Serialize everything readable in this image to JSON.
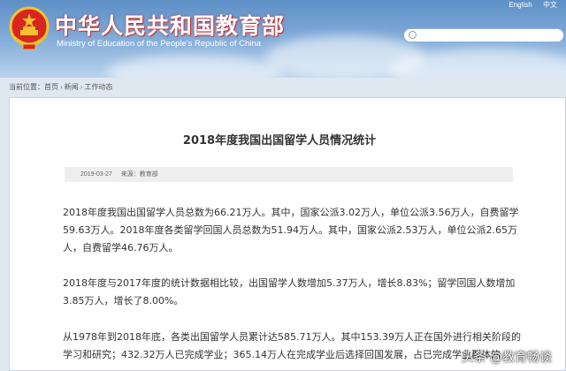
{
  "header": {
    "site_title": "中华人民共和国教育部",
    "site_subtitle": "Ministry of Education of the People's Republic of China",
    "lang_links": [
      "English",
      "中文"
    ]
  },
  "breadcrumb": {
    "label": "当前位置：",
    "items": [
      "首页",
      "新闻",
      "工作动态"
    ]
  },
  "article": {
    "title": "2018年度我国出国留学人员情况统计",
    "date": "2019-03-27",
    "source": "来源：教育部",
    "paragraphs": [
      "2018年度我国出国留学人员总数为66.21万人。其中，国家公派3.02万人，单位公派3.56万人，自费留学59.63万人。2018年度各类留学回国人员总数为51.94万人。其中，国家公派2.53万人，单位公派2.65万人，自费留学46.76万人。",
      "2018年度与2017年度的统计数据相比较，出国留学人数增加5.37万人，增长8.83%；留学回国人数增加3.85万人，增长了8.00%。",
      "从1978年到2018年底，各类出国留学人员累计达585.71万人。其中153.39万人正在国外进行相关阶段的学习和研究；432.32万人已完成学业；365.14万人在完成学业后选择回国发展，占已完成学业群体的"
    ]
  },
  "watermark": "头条 @教育畅谈"
}
